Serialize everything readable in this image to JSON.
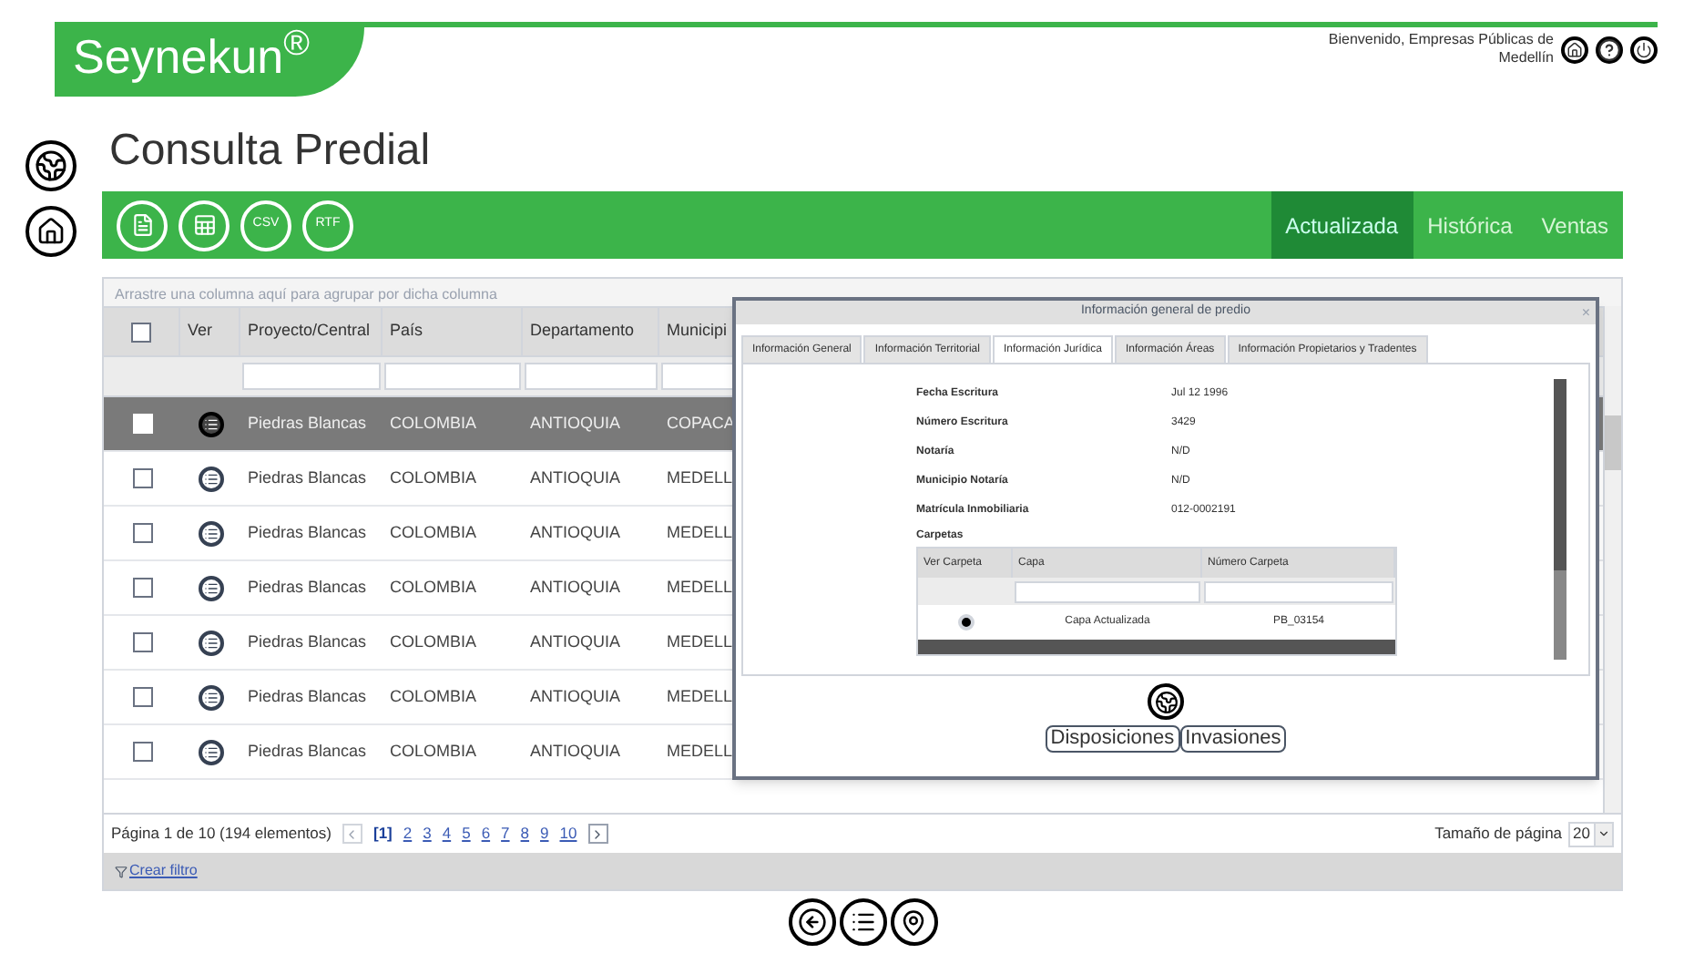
{
  "header": {
    "logo": "Seynekun$^{®}$",
    "welcome": "Bienvenido, Empresas Públicas de Medellín"
  },
  "page": {
    "title": "Consulta Predial"
  },
  "toolbar": {
    "exports": [
      {
        "kind": "pdf"
      },
      {
        "kind": "excel"
      },
      {
        "kind": "text",
        "label": "CSV"
      },
      {
        "kind": "text",
        "label": "RTF"
      }
    ],
    "tabs": [
      {
        "label": "Actualizada",
        "selected": true
      },
      {
        "label": "Histórica",
        "selected": false
      },
      {
        "label": "Ventas",
        "selected": false
      }
    ]
  },
  "grid": {
    "group_hint": "Arrastre una columna aquí para agrupar por dicha columna",
    "all_checked": false,
    "columns": [
      "Ver",
      "Proyecto/Central",
      "País",
      "Departamento",
      "Municipi"
    ],
    "rows": [
      {
        "selected": true,
        "checked": false,
        "proyecto": "Piedras Blancas",
        "pais": "COLOMBIA",
        "departamento": "ANTIOQUIA",
        "municipio": "COPACA"
      },
      {
        "selected": false,
        "checked": false,
        "proyecto": "Piedras Blancas",
        "pais": "COLOMBIA",
        "departamento": "ANTIOQUIA",
        "municipio": "MEDELL"
      },
      {
        "selected": false,
        "checked": false,
        "proyecto": "Piedras Blancas",
        "pais": "COLOMBIA",
        "departamento": "ANTIOQUIA",
        "municipio": "MEDELL"
      },
      {
        "selected": false,
        "checked": false,
        "proyecto": "Piedras Blancas",
        "pais": "COLOMBIA",
        "departamento": "ANTIOQUIA",
        "municipio": "MEDELL"
      },
      {
        "selected": false,
        "checked": false,
        "proyecto": "Piedras Blancas",
        "pais": "COLOMBIA",
        "departamento": "ANTIOQUIA",
        "municipio": "MEDELL"
      },
      {
        "selected": false,
        "checked": false,
        "proyecto": "Piedras Blancas",
        "pais": "COLOMBIA",
        "departamento": "ANTIOQUIA",
        "municipio": "MEDELL"
      },
      {
        "selected": false,
        "checked": false,
        "proyecto": "Piedras Blancas",
        "pais": "COLOMBIA",
        "departamento": "ANTIOQUIA",
        "municipio": "MEDELL"
      }
    ],
    "pager": {
      "summary": "Página 1 de 10 (194 elementos)",
      "pages": [
        {
          "label": "[1]",
          "selected": true
        },
        {
          "label": "2",
          "selected": false
        },
        {
          "label": "3",
          "selected": false
        },
        {
          "label": "4",
          "selected": false
        },
        {
          "label": "5",
          "selected": false
        },
        {
          "label": "6",
          "selected": false
        },
        {
          "label": "7",
          "selected": false
        },
        {
          "label": "8",
          "selected": false
        },
        {
          "label": "9",
          "selected": false
        },
        {
          "label": "10",
          "selected": false
        }
      ],
      "page_size_label": "Tamaño de página",
      "page_size": "20"
    },
    "filter_link": "Crear filtro"
  },
  "dialog": {
    "title": "Información general de predio",
    "close": "×",
    "tabs": [
      {
        "label": "Información General",
        "selected": false
      },
      {
        "label": "Información Territorial",
        "selected": false
      },
      {
        "label": "Información Jurídica",
        "selected": true
      },
      {
        "label": "Información Áreas",
        "selected": false
      },
      {
        "label": "Información Propietarios y Tradentes",
        "selected": false
      }
    ],
    "fields": [
      {
        "label": "Fecha Escritura",
        "value": "Jul 12 1996"
      },
      {
        "label": "Número Escritura",
        "value": "3429"
      },
      {
        "label": "Notaría",
        "value": "N/D"
      },
      {
        "label": "Municipio Notaría",
        "value": "N/D"
      },
      {
        "label": "Matrícula Inmobiliaria",
        "value": "012-0002191"
      }
    ],
    "folders": {
      "title": "Carpetas",
      "columns": [
        "Ver Carpeta",
        "Capa",
        "Número Carpeta"
      ],
      "rows": [
        {
          "capa": "Capa Actualizada",
          "numero": "PB_03154"
        }
      ]
    },
    "buttons": [
      "Disposiciones",
      "Invasiones"
    ]
  }
}
